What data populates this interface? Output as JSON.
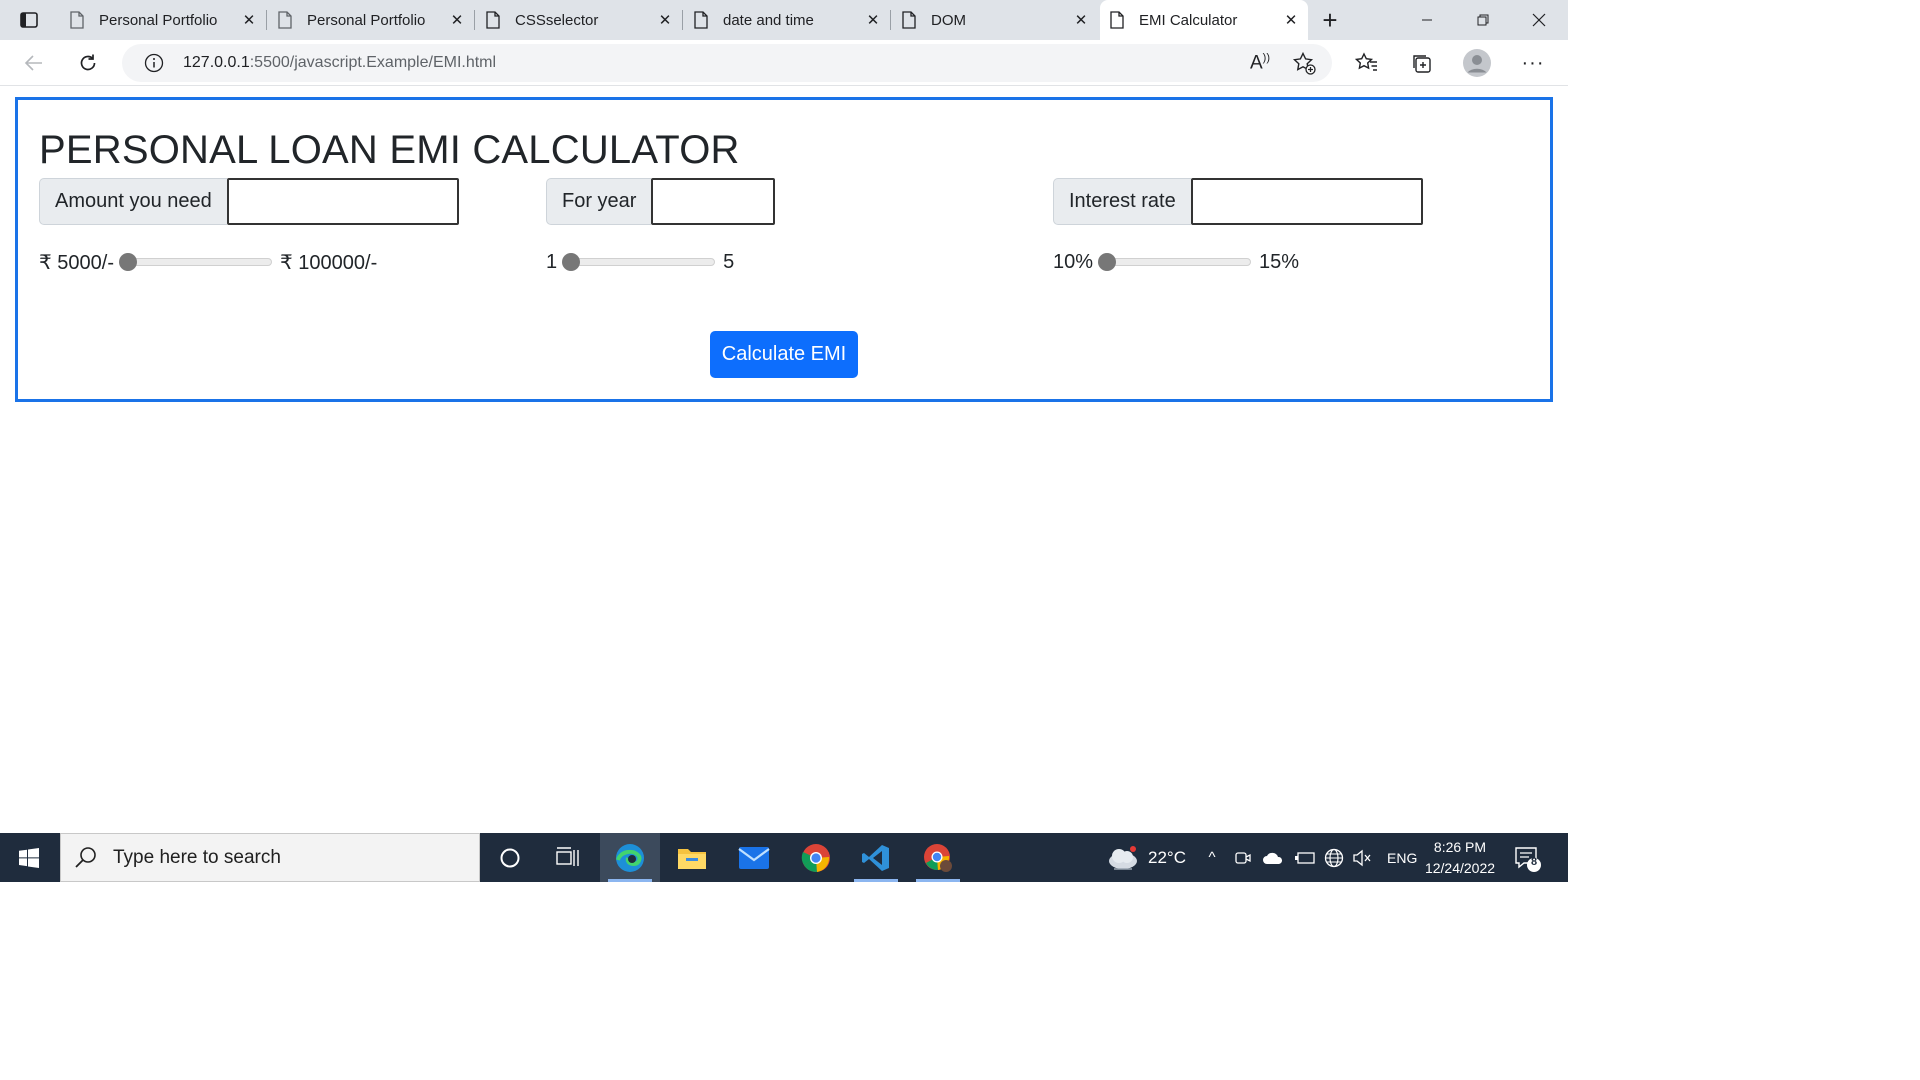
{
  "browser": {
    "tabs": [
      {
        "title": "Personal Portfolio",
        "active": false
      },
      {
        "title": "Personal Portfolio",
        "active": false
      },
      {
        "title": "CSSselector",
        "active": false
      },
      {
        "title": "date and time",
        "active": false
      },
      {
        "title": "DOM",
        "active": false
      },
      {
        "title": "EMI Calculator",
        "active": true
      }
    ],
    "url_host": "127.0.0.1",
    "url_path": ":5500/javascript.Example/EMI.html"
  },
  "page": {
    "heading": "PERSONAL LOAN EMI CALCULATOR",
    "amount": {
      "label": "Amount you need",
      "value": "",
      "min_label": "₹ 5000/-",
      "max_label": "₹ 100000/-",
      "slider_fraction": 0
    },
    "years": {
      "label": "For year",
      "value": "",
      "min_label": "1",
      "max_label": "5",
      "slider_fraction": 0
    },
    "interest": {
      "label": "Interest rate",
      "value": "",
      "min_label": "10%",
      "max_label": "15%",
      "slider_fraction": 0
    },
    "calculate_button": "Calculate EMI",
    "accent_color": "#1a73e8",
    "button_color": "#0d6efd"
  },
  "taskbar": {
    "search_placeholder": "Type here to search",
    "weather_temp": "22°C",
    "language": "ENG",
    "time": "8:26 PM",
    "date": "12/24/2022",
    "notification_count": "8",
    "apps": [
      "cortana-icon",
      "task-view-icon",
      "edge-icon",
      "file-explorer-icon",
      "mail-icon",
      "chrome-icon",
      "vscode-icon",
      "chrome-profile-icon"
    ]
  }
}
